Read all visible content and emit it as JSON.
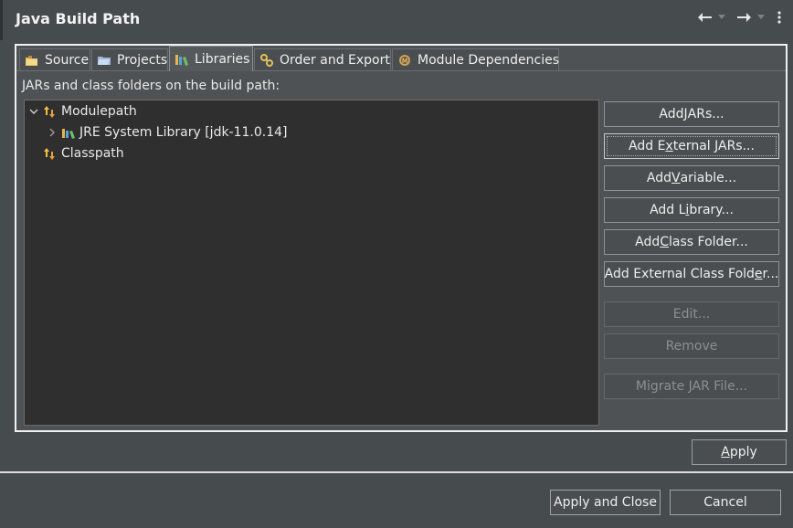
{
  "header": {
    "title": "Java Build Path"
  },
  "tabs": [
    {
      "label": "Source",
      "icon": "source-folder-icon",
      "active": false
    },
    {
      "label": "Projects",
      "icon": "projects-icon",
      "active": false
    },
    {
      "label": "Libraries",
      "icon": "libraries-icon",
      "active": true
    },
    {
      "label": "Order and Export",
      "icon": "order-export-icon",
      "active": false
    },
    {
      "label": "Module Dependencies",
      "icon": "module-icon",
      "active": false
    }
  ],
  "libraries": {
    "description": "JARs and class folders on the build path:",
    "tree": [
      {
        "label": "Modulepath",
        "expanded": true,
        "level": 0,
        "icon": "path-icon"
      },
      {
        "label": "JRE System Library [jdk-11.0.14]",
        "expanded": false,
        "level": 1,
        "icon": "library-icon"
      },
      {
        "label": "Classpath",
        "level": 0,
        "icon": "path-icon"
      }
    ]
  },
  "buttons": {
    "add_jars": {
      "pre": "Add ",
      "u": "J",
      "post": "ARs..."
    },
    "add_external_jars": {
      "pre": "Add E",
      "u": "x",
      "post": "ternal JARs..."
    },
    "add_variable": {
      "pre": "Add ",
      "u": "V",
      "post": "ariable..."
    },
    "add_library": {
      "pre": "Add L",
      "u": "i",
      "post": "brary..."
    },
    "add_class_folder": {
      "pre": "Add ",
      "u": "C",
      "post": "lass Folder..."
    },
    "add_external_class_folder": {
      "pre": "Add External Class Fold",
      "u": "e",
      "post": "r..."
    },
    "edit": "Edit...",
    "remove": "Remove",
    "migrate": "Migrate JAR File..."
  },
  "footer": {
    "apply": {
      "u": "A",
      "post": "pply"
    },
    "apply_and_close": "Apply and Close",
    "cancel": "Cancel"
  },
  "colors": {
    "background": "#464b4e",
    "tree_background": "#2f2f2f",
    "text": "#eeeeee",
    "disabled_text": "#8c8f91"
  }
}
